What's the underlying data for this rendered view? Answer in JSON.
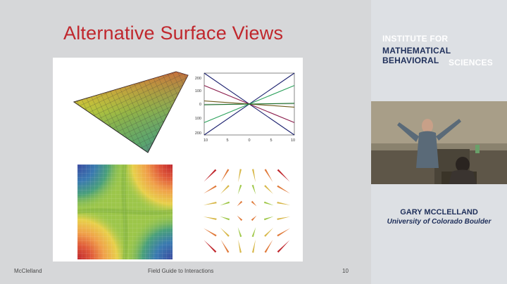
{
  "slide": {
    "title": "Alternative Surface Views",
    "footer_left": "McClelland",
    "footer_center": "Field Guide to Interactions",
    "page_number": "10"
  },
  "line_chart": {
    "y_ticks": [
      "200",
      "100",
      "0",
      "100",
      "200"
    ],
    "x_ticks": [
      "10",
      "5",
      "0",
      "5",
      "10"
    ]
  },
  "chart_data": {
    "type": "line",
    "x": [
      -10,
      10
    ],
    "series": [
      {
        "color": "#1a1f6e",
        "values": [
          -200,
          200
        ]
      },
      {
        "color": "#1a1f6e",
        "values": [
          200,
          -200
        ]
      },
      {
        "color": "#8a1a4a",
        "values": [
          120,
          -120
        ]
      },
      {
        "color": "#2aa05a",
        "values": [
          -120,
          120
        ]
      },
      {
        "color": "#6e5a1a",
        "values": [
          20,
          -20
        ]
      },
      {
        "color": "#1a6e2a",
        "values": [
          -5,
          5
        ]
      }
    ],
    "xlim": [
      -10,
      10
    ],
    "ylim": [
      -200,
      200
    ]
  },
  "sidebar": {
    "institute_line1": "INSTITUTE FOR",
    "institute_line2": "MATHEMATICAL BEHAVIORAL",
    "institute_line3": "SCIENCES",
    "speaker_name": "GARY MCCLELLAND",
    "speaker_affiliation": "University of Colorado Boulder"
  },
  "colors": {
    "title_red": "#c0272d",
    "institute_white": "#ffffff",
    "institute_navy": "#1f2f5a"
  }
}
